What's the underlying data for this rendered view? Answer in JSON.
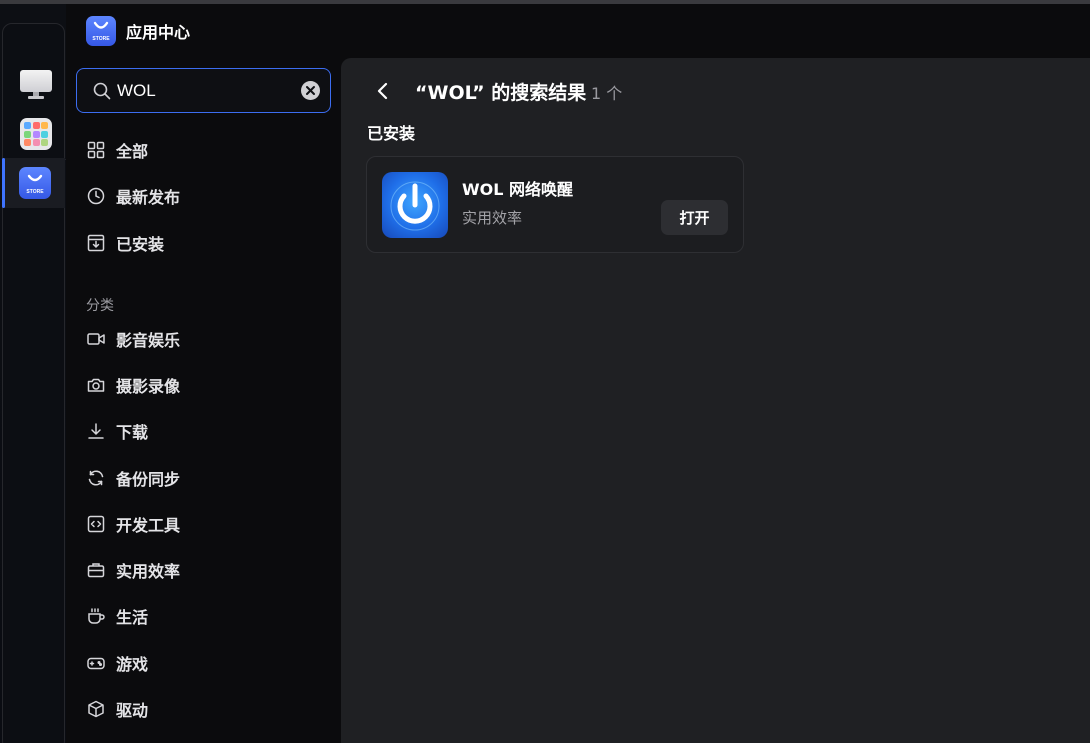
{
  "app": {
    "title": "应用中心",
    "store_logo": "STORE"
  },
  "search": {
    "value": "WOL"
  },
  "sidebar": {
    "main_items": [
      {
        "label": "全部",
        "icon": "grid-icon"
      },
      {
        "label": "最新发布",
        "icon": "clock-icon"
      },
      {
        "label": "已安装",
        "icon": "installed-icon"
      }
    ],
    "section_label": "分类",
    "categories": [
      {
        "label": "影音娱乐",
        "icon": "video-icon"
      },
      {
        "label": "摄影录像",
        "icon": "camera-icon"
      },
      {
        "label": "下载",
        "icon": "download-icon"
      },
      {
        "label": "备份同步",
        "icon": "sync-icon"
      },
      {
        "label": "开发工具",
        "icon": "code-icon"
      },
      {
        "label": "实用效率",
        "icon": "briefcase-icon"
      },
      {
        "label": "生活",
        "icon": "coffee-icon"
      },
      {
        "label": "游戏",
        "icon": "gamepad-icon"
      },
      {
        "label": "驱动",
        "icon": "cube-icon"
      }
    ]
  },
  "results": {
    "title": "“WOL” 的搜索结果",
    "count": "1 个",
    "installed_heading": "已安装",
    "apps": [
      {
        "name": "WOL 网络唤醒",
        "category": "实用效率",
        "action_label": "打开"
      }
    ]
  },
  "colors": {
    "accent": "#3f74ff",
    "main_bg": "#1f2023",
    "sidebar_bg": "#0b0b0d"
  }
}
